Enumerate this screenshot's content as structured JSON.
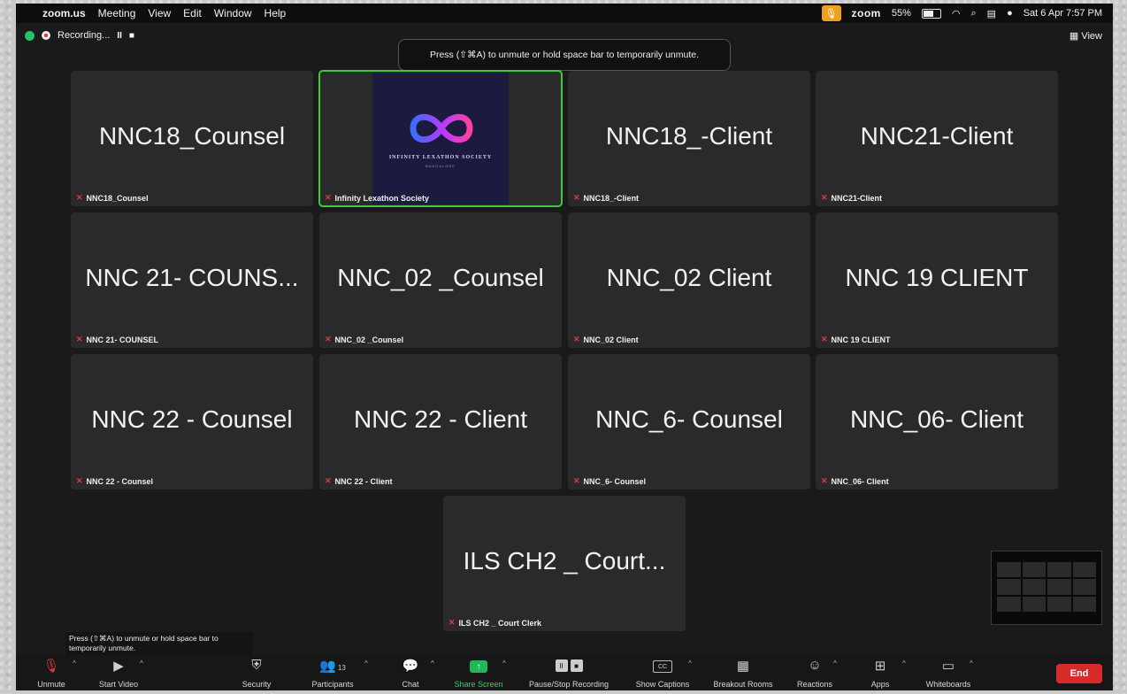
{
  "menubar": {
    "apple": "",
    "items": [
      "zoom.us",
      "Meeting",
      "View",
      "Edit",
      "Window",
      "Help"
    ],
    "zoom_label": "zoom",
    "battery": "55%",
    "datetime": "Sat 6 Apr  7:57 PM"
  },
  "meeting_bar": {
    "recording_label": "Recording...",
    "pause_glyph": "II",
    "stop_glyph": "■",
    "view_label": "View",
    "top_tooltip": "Press (⇧⌘A) to unmute or hold space bar to temporarily unmute."
  },
  "tiles": [
    {
      "big": "NNC18_Counsel",
      "label": "NNC18_Counsel"
    },
    {
      "big": "",
      "label": "Infinity Lexathon Society",
      "logo_text": "INFINITY LEXATHON SOCIETY",
      "logo_sub": "BANGALORE"
    },
    {
      "big": "NNC18_-Client",
      "label": "NNC18_-Client"
    },
    {
      "big": "NNC21-Client",
      "label": "NNC21-Client"
    },
    {
      "big": "NNC 21- COUNS...",
      "label": "NNC 21- COUNSEL"
    },
    {
      "big": "NNC_02 _Counsel",
      "label": "NNC_02 _Counsel"
    },
    {
      "big": "NNC_02 Client",
      "label": "NNC_02 Client"
    },
    {
      "big": "NNC 19 CLIENT",
      "label": "NNC 19 CLIENT"
    },
    {
      "big": "NNC 22 - Counsel",
      "label": "NNC 22 - Counsel"
    },
    {
      "big": "NNC 22 - Client",
      "label": "NNC 22 - Client"
    },
    {
      "big": "NNC_6- Counsel",
      "label": "NNC_6- Counsel"
    },
    {
      "big": "NNC_06- Client",
      "label": "NNC_06- Client"
    },
    {
      "big": "ILS CH2 _ Court...",
      "label": "ILS CH2 _ Court Clerk"
    }
  ],
  "bottom_tooltip": "Press (⇧⌘A) to unmute or hold space bar to temporarily unmute.",
  "toolbar": {
    "unmute": "Unmute",
    "start_video": "Start Video",
    "security": "Security",
    "participants": "Participants",
    "participants_count": "13",
    "chat": "Chat",
    "share_screen": "Share Screen",
    "pause_stop_recording": "Pause/Stop Recording",
    "show_captions": "Show Captions",
    "cc": "CC",
    "breakout_rooms": "Breakout Rooms",
    "reactions": "Reactions",
    "apps": "Apps",
    "whiteboards": "Whiteboards",
    "end": "End"
  },
  "colors": {
    "active_speaker": "#3fc93f",
    "end": "#d92a2a",
    "share": "#21b85a",
    "mute": "#e03a3a"
  }
}
